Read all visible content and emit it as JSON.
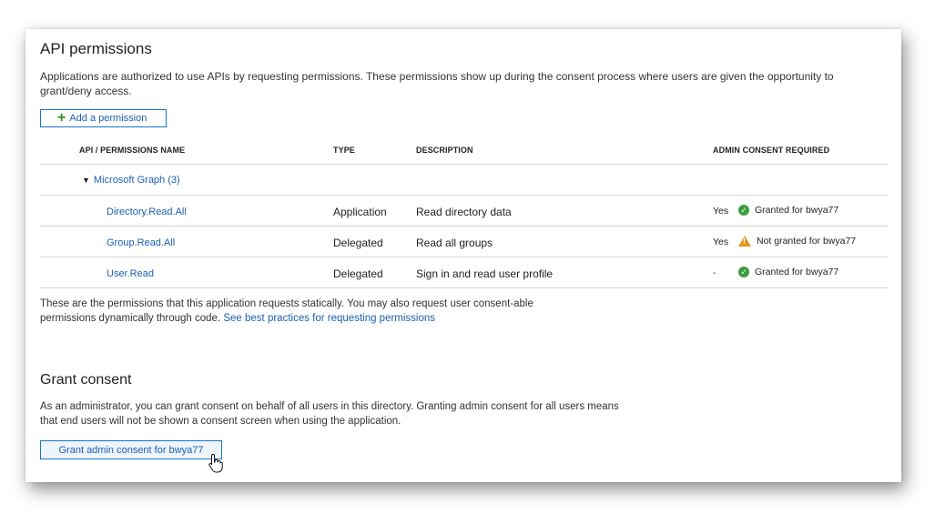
{
  "api_permissions": {
    "title": "API permissions",
    "description": "Applications are authorized to use APIs by requesting permissions. These permissions show up during the consent process where users are given the opportunity to grant/deny access.",
    "add_button_label": "Add a permission",
    "columns": {
      "name": "API / PERMISSIONS NAME",
      "type": "TYPE",
      "description": "DESCRIPTION",
      "admin_consent": "ADMIN CONSENT REQUIRED"
    },
    "group": {
      "label": "Microsoft Graph (3)"
    },
    "rows": [
      {
        "name": "Directory.Read.All",
        "type": "Application",
        "description": "Read directory data",
        "admin_consent": "Yes",
        "status_icon": "check-circle-icon",
        "status_text": "Granted for bwya77"
      },
      {
        "name": "Group.Read.All",
        "type": "Delegated",
        "description": "Read all groups",
        "admin_consent": "Yes",
        "status_icon": "warning-icon",
        "status_text": "Not granted for bwya77"
      },
      {
        "name": "User.Read",
        "type": "Delegated",
        "description": "Sign in and read user profile",
        "admin_consent": "-",
        "status_icon": "check-circle-icon",
        "status_text": "Granted for bwya77"
      }
    ],
    "note_text": "These are the permissions that this application requests statically. You may also request user consent-able permissions dynamically through code.",
    "note_link": "See best practices for requesting permissions"
  },
  "grant_consent": {
    "title": "Grant consent",
    "description": "As an administrator, you can grant consent on behalf of all users in this directory. Granting admin consent for all users means that end users will not be shown a consent screen when using the application.",
    "button_label": "Grant admin consent for bwya77"
  },
  "colors": {
    "link": "#1a5fb4",
    "success": "#3a9e3a",
    "warning": "#e8951a"
  }
}
